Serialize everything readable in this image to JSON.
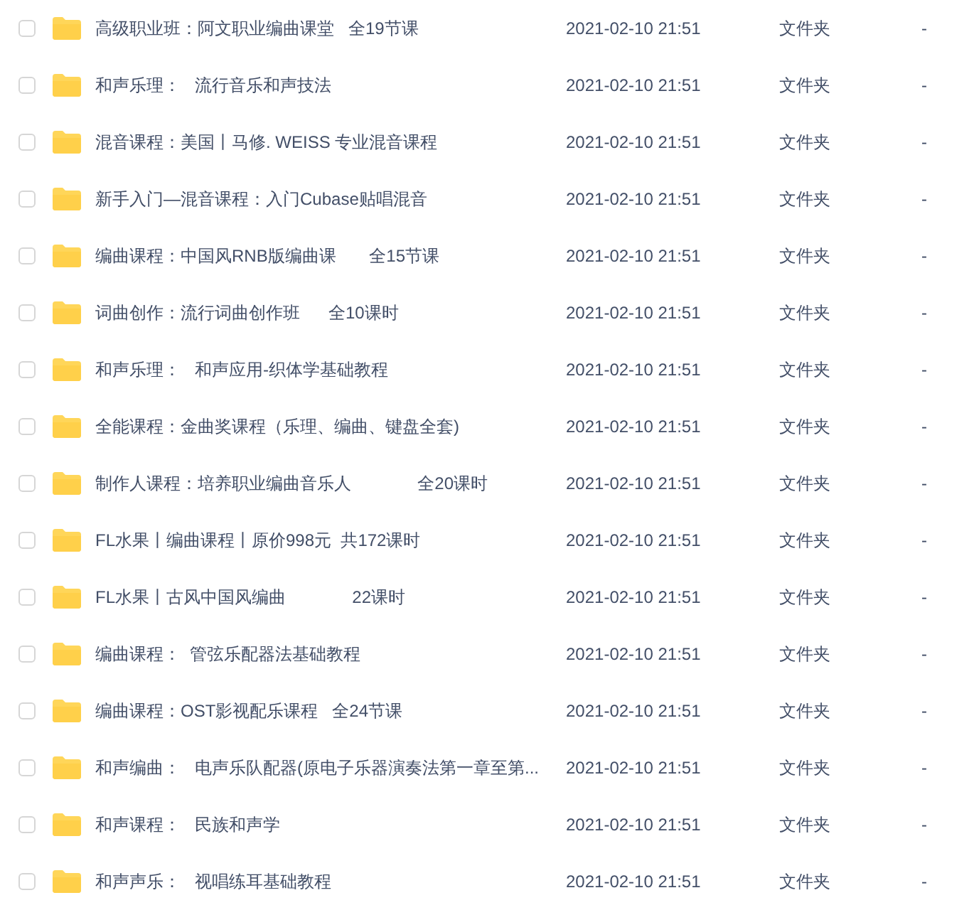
{
  "files": [
    {
      "name": "高级职业班：阿文职业编曲课堂   全19节课",
      "modified": "2021-02-10 21:51",
      "type": "文件夹",
      "size": "-",
      "checked": false
    },
    {
      "name": "和声乐理：   流行音乐和声技法",
      "modified": "2021-02-10 21:51",
      "type": "文件夹",
      "size": "-",
      "checked": false
    },
    {
      "name": "混音课程：美国丨马修. WEISS 专业混音课程",
      "modified": "2021-02-10 21:51",
      "type": "文件夹",
      "size": "-",
      "checked": false
    },
    {
      "name": "新手入门—混音课程：入门Cubase贴唱混音",
      "modified": "2021-02-10 21:51",
      "type": "文件夹",
      "size": "-",
      "checked": false
    },
    {
      "name": "编曲课程：中国风RNB版编曲课       全15节课",
      "modified": "2021-02-10 21:51",
      "type": "文件夹",
      "size": "-",
      "checked": false
    },
    {
      "name": "词曲创作：流行词曲创作班      全10课时",
      "modified": "2021-02-10 21:51",
      "type": "文件夹",
      "size": "-",
      "checked": false
    },
    {
      "name": "和声乐理：   和声应用-织体学基础教程",
      "modified": "2021-02-10 21:51",
      "type": "文件夹",
      "size": "-",
      "checked": false
    },
    {
      "name": "全能课程：金曲奖课程（乐理、编曲、键盘全套)",
      "modified": "2021-02-10 21:51",
      "type": "文件夹",
      "size": "-",
      "checked": false
    },
    {
      "name": "制作人课程：培养职业编曲音乐人              全20课时",
      "modified": "2021-02-10 21:51",
      "type": "文件夹",
      "size": "-",
      "checked": false
    },
    {
      "name": "FL水果丨编曲课程丨原价998元  共172课时",
      "modified": "2021-02-10 21:51",
      "type": "文件夹",
      "size": "-",
      "checked": false
    },
    {
      "name": "FL水果丨古风中国风编曲              22课时",
      "modified": "2021-02-10 21:51",
      "type": "文件夹",
      "size": "-",
      "checked": false
    },
    {
      "name": "编曲课程：  管弦乐配器法基础教程",
      "modified": "2021-02-10 21:51",
      "type": "文件夹",
      "size": "-",
      "checked": false
    },
    {
      "name": "编曲课程：OST影视配乐课程   全24节课",
      "modified": "2021-02-10 21:51",
      "type": "文件夹",
      "size": "-",
      "checked": false
    },
    {
      "name": "和声编曲：   电声乐队配器(原电子乐器演奏法第一章至第...",
      "modified": "2021-02-10 21:51",
      "type": "文件夹",
      "size": "-",
      "checked": false
    },
    {
      "name": "和声课程：   民族和声学",
      "modified": "2021-02-10 21:51",
      "type": "文件夹",
      "size": "-",
      "checked": false
    },
    {
      "name": "和声声乐：   视唱练耳基础教程",
      "modified": "2021-02-10 21:51",
      "type": "文件夹",
      "size": "-",
      "checked": false
    }
  ]
}
